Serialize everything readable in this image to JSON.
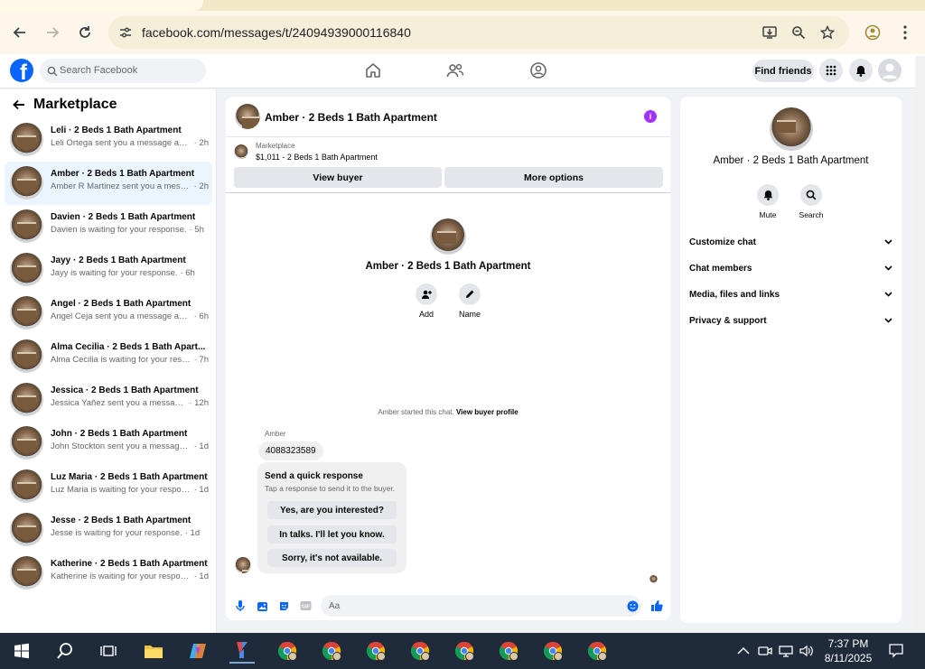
{
  "browser": {
    "url": "facebook.com/messages/t/24094939000116840"
  },
  "header": {
    "search_placeholder": "Search Facebook",
    "find_friends": "Find friends",
    "logo_letter": "f"
  },
  "sidebar": {
    "title": "Marketplace",
    "conversations": [
      {
        "name": "Leli · 2 Beds 1 Bath Apartment",
        "preview": "Leli Ortega sent you a message about...",
        "time": "· 2h"
      },
      {
        "name": "Amber · 2 Beds 1 Bath Apartment",
        "preview": "Amber R Martinez sent you a messag...",
        "time": "· 2h"
      },
      {
        "name": "Davien · 2 Beds 1 Bath Apartment",
        "preview": "Davien is waiting for your response.",
        "time": "· 5h"
      },
      {
        "name": "Jayy · 2 Beds 1 Bath Apartment",
        "preview": "Jayy is waiting for your response.",
        "time": "· 6h"
      },
      {
        "name": "Angel · 2 Beds 1 Bath Apartment",
        "preview": "Angel Ceja sent you a message about ...",
        "time": "· 6h"
      },
      {
        "name": "Alma Cecilia · 2 Beds 1 Bath Apart...",
        "preview": "Alma Cecilia is waiting for your respo...",
        "time": "· 7h"
      },
      {
        "name": "Jessica · 2 Beds 1 Bath Apartment",
        "preview": "Jessica Yañez sent you a message ab...",
        "time": "· 12h"
      },
      {
        "name": "John · 2 Beds 1 Bath Apartment",
        "preview": "John Stockton sent you a message ab...",
        "time": "· 1d"
      },
      {
        "name": "Luz Maria · 2 Beds 1 Bath Apartment",
        "preview": "Luz Maria is waiting for your response.",
        "time": "· 1d"
      },
      {
        "name": "Jesse · 2 Beds 1 Bath Apartment",
        "preview": "Jesse is waiting for your response.",
        "time": "· 1d"
      },
      {
        "name": "Katherine · 2 Beds 1 Bath Apartment",
        "preview": "Katherine is waiting for your response.",
        "time": "· 1d"
      }
    ]
  },
  "chat": {
    "title": "Amber · 2 Beds 1 Bath Apartment",
    "marketplace_label": "Marketplace",
    "listing": "$1,011 - 2 Beds 1 Bath Apartment",
    "view_buyer": "View buyer",
    "more_options": "More options",
    "center_name": "Amber · 2 Beds 1 Bath Apartment",
    "add_label": "Add",
    "name_label": "Name",
    "started_text": "Amber started this chat.",
    "view_buyer_profile": "View buyer profile",
    "sender": "Amber",
    "message": "4088323589",
    "quick_title": "Send a quick response",
    "quick_subtitle": "Tap a response to send it to the buyer.",
    "quick_replies": [
      "Yes, are you interested?",
      "In talks. I'll let you know.",
      "Sorry, it's not available."
    ],
    "composer_placeholder": "Aa",
    "gif_label": "GIF"
  },
  "details": {
    "name": "Amber · 2 Beds 1 Bath Apartment",
    "mute": "Mute",
    "search": "Search",
    "sections": [
      "Customize chat",
      "Chat members",
      "Media, files and links",
      "Privacy & support"
    ]
  },
  "taskbar": {
    "time": "7:37 PM",
    "date": "8/11/2025"
  },
  "colors": {
    "fb_blue": "#0866ff",
    "active_conv": "#ebf5ff",
    "info_purple": "#a033ff"
  }
}
